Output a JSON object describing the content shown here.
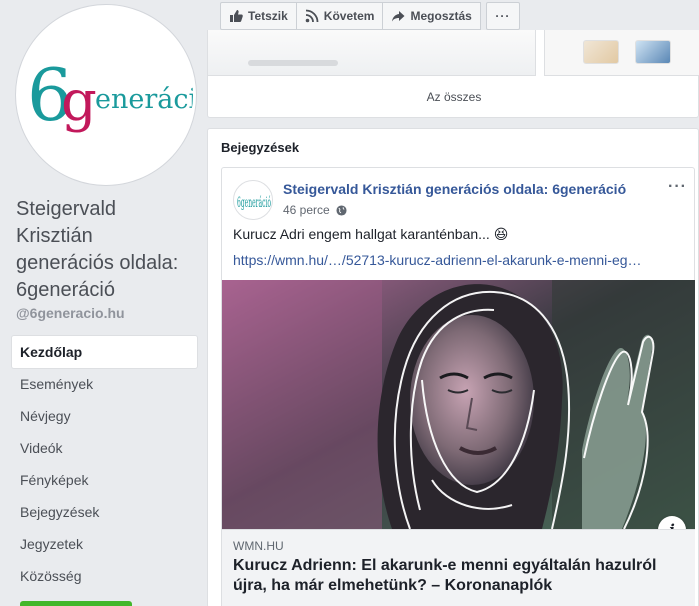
{
  "sidebar": {
    "logo_text": {
      "six": "6",
      "g": "g",
      "rest": "eneráció"
    },
    "page_name": "Steigervald Krisztián generációs oldala: 6generáció",
    "handle": "@6generacio.hu",
    "nav": [
      {
        "label": "Kezdőlap",
        "active": true
      },
      {
        "label": "Események"
      },
      {
        "label": "Névjegy"
      },
      {
        "label": "Videók"
      },
      {
        "label": "Fényképek"
      },
      {
        "label": "Bejegyzések"
      },
      {
        "label": "Jegyzetek"
      },
      {
        "label": "Közösség"
      }
    ]
  },
  "actions": {
    "like": "Tetszik",
    "follow": "Követem",
    "share": "Megosztás",
    "more": "···"
  },
  "photos": {
    "all_link": "Az összes"
  },
  "posts": {
    "section_title": "Bejegyzések",
    "post": {
      "author": "Steigervald Krisztián generációs oldala: 6generáció",
      "avatar_text": "6generáció",
      "time": "46 perce",
      "more": "···",
      "text": "Kurucz Adri engem hallgat karanténban... 😆",
      "link": "https://wmn.hu/…/52713-kurucz-adrienn-el-akarunk-e-menni-eg…",
      "preview": {
        "domain": "WMN.HU",
        "title": "Kurucz Adrienn: El akarunk-e menni egyáltalán hazulról újra, ha már elmehetünk? – Koronanaplók",
        "info": "i"
      }
    }
  },
  "colors": {
    "logo_teal": "#1a9a9c",
    "logo_pink": "#c2185b",
    "link_blue": "#365899",
    "page_bg": "#e9ebee"
  }
}
